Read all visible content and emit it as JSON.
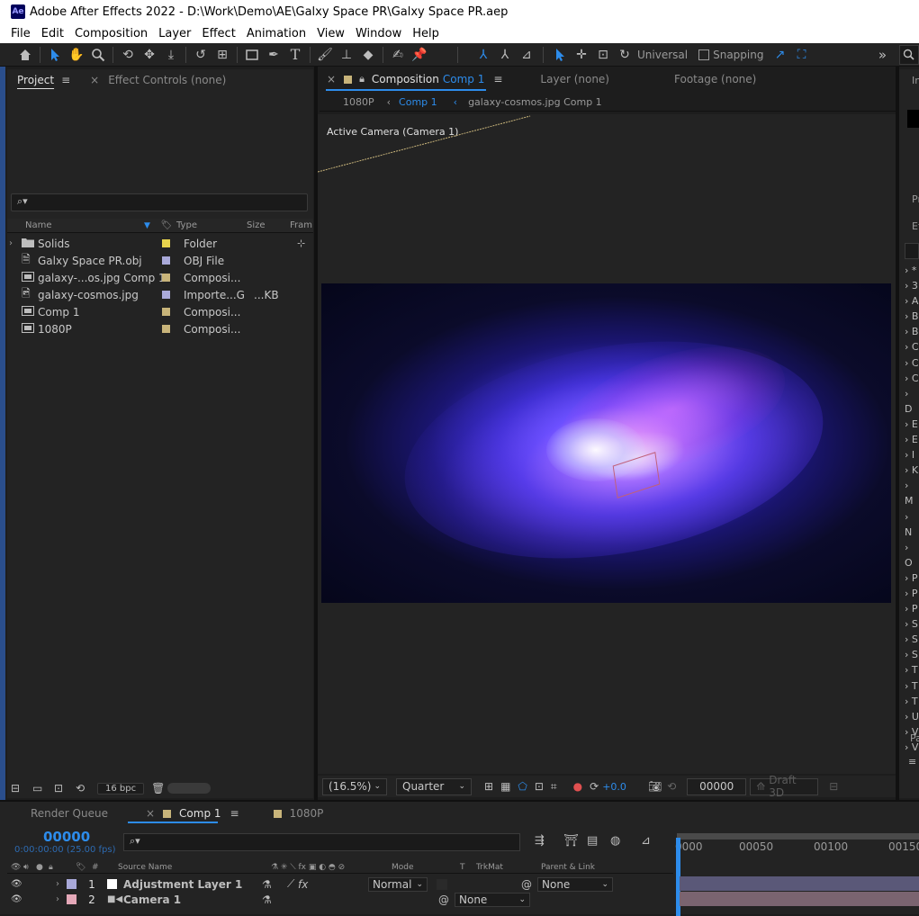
{
  "window": {
    "app_logo": "Ae",
    "title": "Adobe After Effects 2022 - D:\\Work\\Demo\\AE\\Galxy Space PR\\Galxy Space PR.aep"
  },
  "menu": [
    "File",
    "Edit",
    "Composition",
    "Layer",
    "Effect",
    "Animation",
    "View",
    "Window",
    "Help"
  ],
  "toolbar": {
    "axis_mode": "Universal",
    "snapping_label": "Snapping",
    "overflow": "»"
  },
  "project_panel": {
    "tab_project": "Project",
    "tab_effect_controls": "Effect Controls (none)",
    "columns": {
      "name": "Name",
      "type": "Type",
      "size": "Size",
      "frame": "Fram"
    },
    "items": [
      {
        "name": "Solids",
        "type": "Folder",
        "size": "",
        "color": "#e8d44d",
        "icon": "folder-icon"
      },
      {
        "name": "Galxy Space PR.obj",
        "type": "OBJ File",
        "size": "",
        "color": "#a9a9d9",
        "icon": "obj-file-icon"
      },
      {
        "name": "galaxy-...os.jpg Comp 1",
        "type": "Composi...",
        "size": "",
        "color": "#c8b47a",
        "icon": "composition-icon"
      },
      {
        "name": "galaxy-cosmos.jpg",
        "type": "Importe...G",
        "size": "...KB",
        "color": "#a9a9d9",
        "icon": "image-file-icon"
      },
      {
        "name": "Comp 1",
        "type": "Composi...",
        "size": "",
        "color": "#c8b47a",
        "icon": "composition-icon"
      },
      {
        "name": "1080P",
        "type": "Composi...",
        "size": "",
        "color": "#c8b47a",
        "icon": "composition-icon"
      }
    ],
    "bit_depth": "16 bpc"
  },
  "composition_panel": {
    "tab_composition_prefix": "Composition",
    "tab_composition_name": "Comp 1",
    "tab_layer": "Layer (none)",
    "tab_footage": "Footage (none)",
    "breadcrumbs": [
      "1080P",
      "Comp 1",
      "galaxy-cosmos.jpg Comp 1"
    ],
    "camera_label": "Active Camera (Camera 1)",
    "zoom": "(16.5%)",
    "resolution": "Quarter",
    "exposure": "+0.0",
    "timecode": "00000",
    "renderer": "Draft 3D"
  },
  "right_panel": {
    "labels": [
      "In",
      "Pr",
      "Ef",
      "Pa"
    ],
    "effect_categories": [
      "*",
      "3",
      "A",
      "B",
      "B",
      "C",
      "C",
      "C",
      "D",
      "E",
      "E",
      "I",
      "K",
      "M",
      "N",
      "O",
      "P",
      "P",
      "P",
      "S",
      "S",
      "S",
      "T",
      "T",
      "T",
      "U",
      "V",
      "V"
    ]
  },
  "timeline": {
    "tab_render_queue": "Render Queue",
    "tab_comp": "Comp 1",
    "tab_1080p": "1080P",
    "current_frame": "00000",
    "timecode_sub": "0:00:00:00 (25.00 fps)",
    "columns": {
      "hash": "#",
      "source": "Source Name",
      "mode": "Mode",
      "t": "T",
      "trkmat": "TrkMat",
      "parent": "Parent & Link"
    },
    "ruler_ticks": [
      "0000",
      "00050",
      "00100",
      "00150"
    ],
    "layers": [
      {
        "num": "1",
        "name": "Adjustment Layer 1",
        "label_color": "#a9a9d9",
        "mode": "Normal",
        "parent": "None",
        "fx": "fx"
      },
      {
        "num": "2",
        "name": "Camera 1",
        "label_color": "#e4a8b8",
        "mode": "",
        "parent": "None",
        "fx": ""
      }
    ]
  },
  "colors": {
    "accent": "#2d8ceb",
    "track_adjustment": "#5a5878",
    "track_camera": "#7a6470"
  }
}
